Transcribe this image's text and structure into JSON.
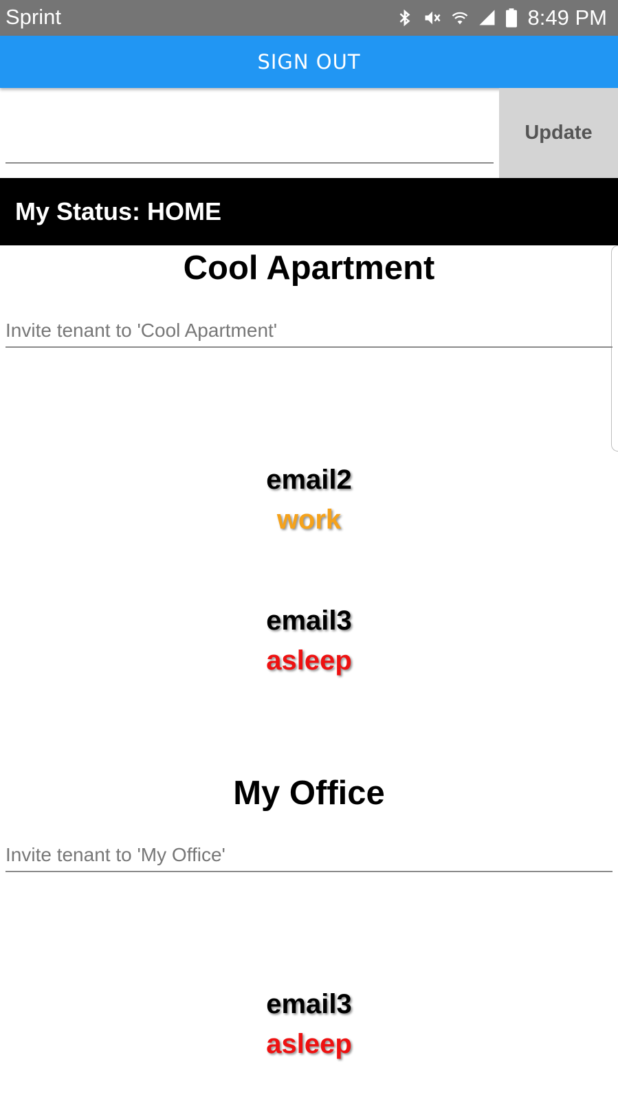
{
  "status_bar": {
    "carrier": "Sprint",
    "time": "8:49 PM",
    "icons": [
      "bluetooth-icon",
      "mute-icon",
      "wifi-icon",
      "signal-icon",
      "battery-icon"
    ]
  },
  "header": {
    "sign_out_label": "SIGN OUT",
    "sign_out_color": "#2196f3"
  },
  "status_update": {
    "input_value": "",
    "update_label": "Update"
  },
  "my_status": {
    "text": "My Status: HOME"
  },
  "houses": [
    {
      "name": "Cool Apartment",
      "invite_placeholder": "Invite tenant to 'Cool Apartment'",
      "tenants": [
        {
          "email": "email2",
          "status": "work",
          "status_color": "#f5a21b"
        },
        {
          "email": "email3",
          "status": "asleep",
          "status_color": "#ee1111"
        }
      ]
    },
    {
      "name": "My Office",
      "invite_placeholder": "Invite tenant to 'My Office'",
      "tenants": [
        {
          "email": "email3",
          "status": "asleep",
          "status_color": "#ee1111"
        }
      ]
    }
  ]
}
